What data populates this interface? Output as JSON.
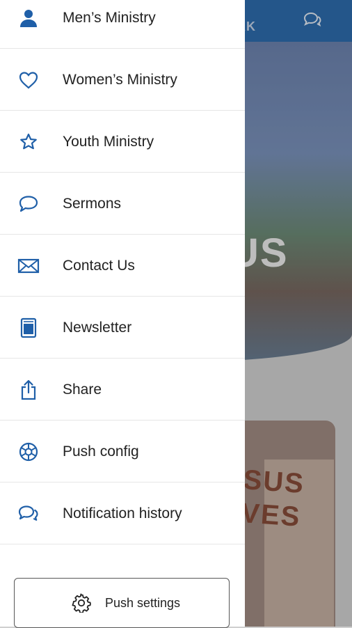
{
  "background": {
    "topbar_text": "RK",
    "hero_word": "US",
    "sign_text": "SUS\nVES",
    "topbar_color": "#2f6fb1"
  },
  "drawer": {
    "accent_color": "#1f5fa8",
    "items": [
      {
        "label": "Men’s Ministry",
        "icon": "person-icon"
      },
      {
        "label": "Women’s Ministry",
        "icon": "heart-icon"
      },
      {
        "label": "Youth Ministry",
        "icon": "star-icon"
      },
      {
        "label": "Sermons",
        "icon": "speech-bubble-icon"
      },
      {
        "label": "Contact Us",
        "icon": "envelope-icon"
      },
      {
        "label": "Newsletter",
        "icon": "newsletter-icon"
      },
      {
        "label": "Share",
        "icon": "share-icon"
      },
      {
        "label": "Push config",
        "icon": "push-config-icon"
      },
      {
        "label": "Notification history",
        "icon": "chat-bubbles-icon"
      }
    ],
    "push_settings_label": "Push settings"
  }
}
